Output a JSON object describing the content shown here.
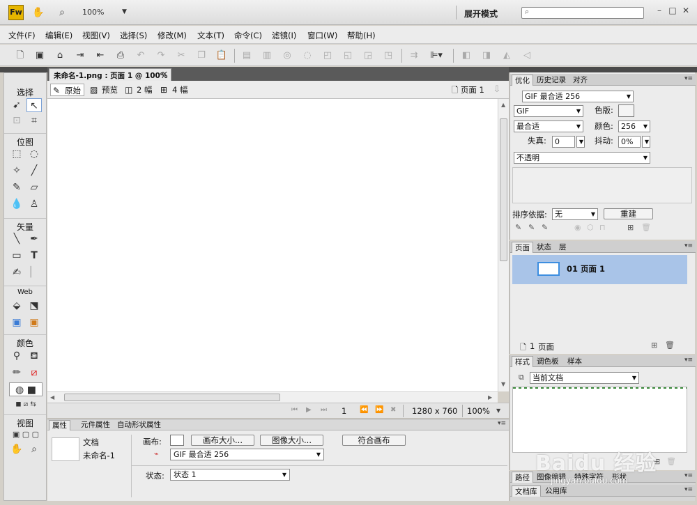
{
  "titlebar": {
    "logo": "Fw",
    "zoom": "100%",
    "workspace": "展开模式",
    "icons": [
      "hand-icon",
      "zoom-icon",
      "search-icon",
      "minimize-icon",
      "maximize-icon",
      "close-icon"
    ]
  },
  "menubar": [
    "文件(F)",
    "编辑(E)",
    "视图(V)",
    "选择(S)",
    "修改(M)",
    "文本(T)",
    "命令(C)",
    "滤镜(I)",
    "窗口(W)",
    "帮助(H)"
  ],
  "document": {
    "tab_title": "未命名-1.png : 页面 1 @ 100%",
    "view_original": "原始",
    "view_preview": "预览",
    "view_2up": "2 幅",
    "view_4up": "4 幅",
    "page_selector": "页面 1",
    "status_page": "1",
    "status_size": "1280 x 760",
    "status_zoom": "100%"
  },
  "tools": {
    "select": "选择",
    "bitmap": "位图",
    "vector": "矢量",
    "web": "Web",
    "colors": "颜色",
    "view": "视图"
  },
  "properties": {
    "tabs": [
      "属性",
      "元件属性",
      "自动形状属性"
    ],
    "doc_type": "文档",
    "doc_name": "未命名-1",
    "canvas_label": "画布:",
    "canvas_size_btn": "画布大小...",
    "image_size_btn": "图像大小...",
    "fit_canvas_btn": "符合画布",
    "export_setting": "GIF 最合适 256",
    "state_label": "状态:",
    "state_value": "状态 1"
  },
  "optimize": {
    "tabs": [
      "优化",
      "历史记录",
      "对齐"
    ],
    "preset": "GIF 最合适 256",
    "format": "GIF",
    "palette_label": "色版:",
    "palette_type": "最合适",
    "colors_label": "颜色:",
    "colors_value": "256",
    "loss_label": "失真:",
    "loss_value": "0",
    "dither_label": "抖动:",
    "dither_value": "0%",
    "transparency": "不透明",
    "sort_label": "排序依据:",
    "sort_value": "无",
    "rebuild_btn": "重建"
  },
  "pages": {
    "tabs": [
      "页面",
      "状态",
      "层"
    ],
    "item_label": "01 页面 1",
    "count": "1",
    "count_label": "页面"
  },
  "styles": {
    "tabs": [
      "样式",
      "调色板",
      "样本"
    ],
    "source": "当前文档"
  },
  "bottom_panels": {
    "row1": [
      "路径",
      "图像编辑",
      "特殊字符",
      "形状"
    ],
    "row2": [
      "文档库",
      "公用库"
    ]
  },
  "watermark": {
    "text": "Baidu 经验",
    "url": "jingyan.baidu.com"
  }
}
